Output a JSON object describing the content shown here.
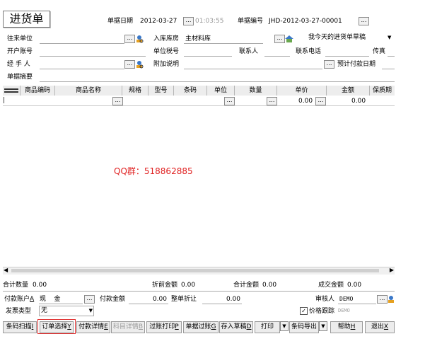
{
  "form": {
    "title": "进货单",
    "doc_date_label": "单据日期",
    "doc_date": "2012-03-27",
    "doc_time": "01:03:55",
    "doc_no_label": "单据编号",
    "doc_no": "JHD-2012-03-27-00001",
    "partner_label": "往来单位",
    "warehouse_label": "入库库房",
    "warehouse_value": "主材料库",
    "draft_label": "我今天的进货单草稿",
    "account_label": "开户账号",
    "tax_label": "单位税号",
    "contact_label": "联系人",
    "phone_label": "联系电话",
    "fax_label": "传真",
    "handler_label": "经 手 人",
    "note_label": "附加说明",
    "pay_date_label": "预计付款日期",
    "summary_label": "单据摘要"
  },
  "table": {
    "columns": [
      "商品编码",
      "商品名称",
      "规格",
      "型号",
      "条码",
      "单位",
      "数量",
      "单价",
      "金额",
      "保质期"
    ],
    "row1": {
      "price": "0.00",
      "amount": "0.00"
    }
  },
  "watermark": "QQ群：518862885",
  "totals": {
    "qty_label": "合计数量",
    "qty_value": "0.00",
    "pre_disc_label": "折前金额",
    "pre_disc_value": "0.00",
    "total_amount_label": "合计金额",
    "total_amount_value": "0.00",
    "deal_amount_label": "成交金额",
    "deal_amount_value": "0.00"
  },
  "payment": {
    "pay_account_label": "付款账户",
    "pay_account_key": "A",
    "pay_account_value": "现    金",
    "pay_amount_label": "付款金额",
    "pay_amount_value": "0.00",
    "discount_label": "整单折让",
    "discount_value": "0.00",
    "auditor_label": "审核人",
    "auditor_value": "DEMO",
    "invoice_label": "发票类型",
    "invoice_value": "无",
    "price_track_label": "价格跟踪",
    "price_track_value": "DEMO"
  },
  "buttons": {
    "barcode_scan": "条码扫描",
    "barcode_scan_key": "I",
    "order_select": "订单选择",
    "order_select_key": "Y",
    "pay_detail": "付款详情",
    "pay_detail_key": "E",
    "subject_detail": "科目详情",
    "subject_detail_key": "B",
    "post_print": "过账打印",
    "post_print_key": "P",
    "post": "单据过账",
    "post_key": "G",
    "save_draft": "存入草稿",
    "save_draft_key": "D",
    "print": "打印",
    "barcode_export": "条码导出",
    "help": "帮助",
    "help_key": "H",
    "exit": "退出",
    "exit_key": "X"
  },
  "colors": {
    "highlight_border": "#e03030",
    "watermark": "#e02020",
    "grid_header": "#ededed"
  }
}
